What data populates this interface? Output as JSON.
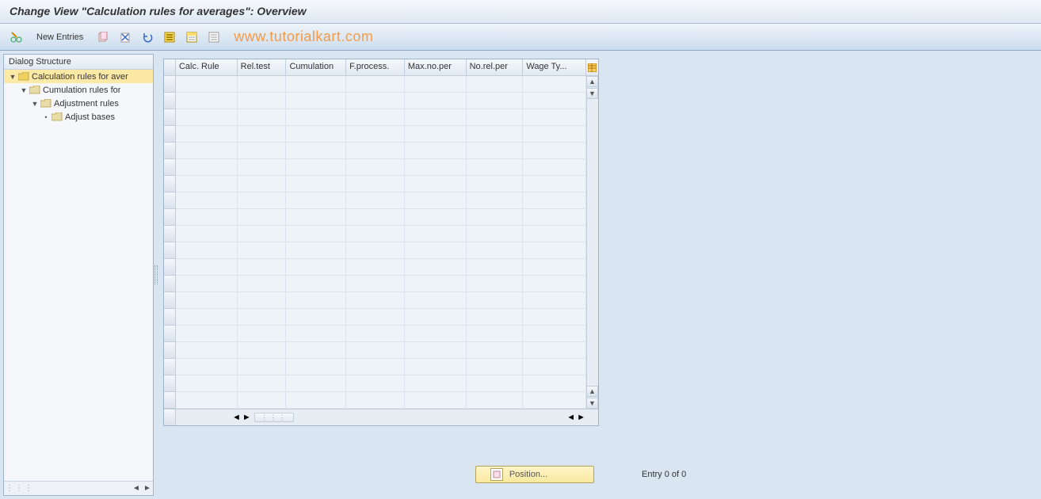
{
  "title": "Change View \"Calculation rules for averages\": Overview",
  "toolbar": {
    "new_entries_label": "New Entries"
  },
  "watermark": "www.tutorialkart.com",
  "tree": {
    "header": "Dialog Structure",
    "items": [
      {
        "label": "Calculation rules for aver",
        "indent": 0,
        "open": true,
        "leaf": false,
        "selected": true,
        "iconColor": "#f0d060"
      },
      {
        "label": "Cumulation rules for",
        "indent": 1,
        "open": true,
        "leaf": false,
        "selected": false,
        "iconColor": "#e8dca8"
      },
      {
        "label": "Adjustment rules",
        "indent": 2,
        "open": true,
        "leaf": false,
        "selected": false,
        "iconColor": "#e8dca8"
      },
      {
        "label": "Adjust bases",
        "indent": 3,
        "open": false,
        "leaf": true,
        "selected": false,
        "iconColor": "#e8dca8"
      }
    ]
  },
  "grid": {
    "columns": [
      "Calc. Rule",
      "Rel.test",
      "Cumulation",
      "F.process.",
      "Max.no.per",
      "No.rel.per",
      "Wage Ty..."
    ],
    "row_count": 20
  },
  "footer": {
    "position_label": "Position...",
    "entry_text": "Entry 0 of 0"
  }
}
